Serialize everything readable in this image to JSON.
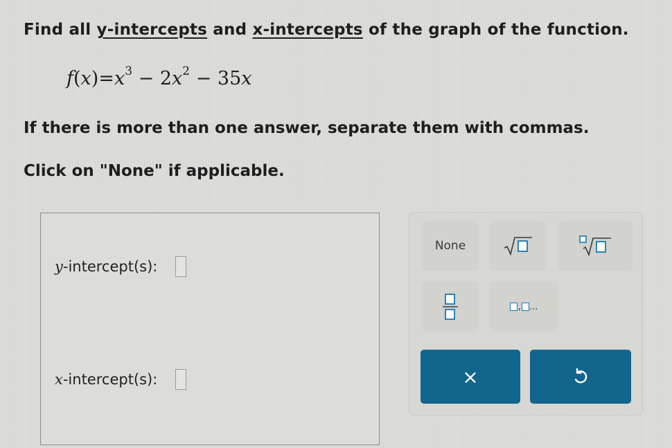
{
  "question": {
    "prefix": "Find all ",
    "term1": "y-intercepts",
    "middle": " and ",
    "term2": "x-intercepts",
    "suffix": " of the graph of the function."
  },
  "function": {
    "name": "f",
    "var": "x",
    "eq": "=",
    "exp1": "3",
    "minus1": "−",
    "coef2": "2",
    "exp2": "2",
    "minus2": "−",
    "coef3": "35"
  },
  "instructions": {
    "line1": "If there is more than one answer, separate them with commas.",
    "line2": "Click on \"None\" if applicable."
  },
  "answers": {
    "y_var": "y",
    "y_label": "-intercept(s):",
    "x_var": "x",
    "x_label": "-intercept(s):"
  },
  "keypad": {
    "none_label": "None",
    "sqrt_icon": "square-root-icon",
    "nroot_icon": "nth-root-icon",
    "fraction_icon": "fraction-icon",
    "list_icon": "list-icon",
    "list_ellipsis": "...",
    "clear_icon": "x-icon",
    "clear_label": "×",
    "undo_icon": "undo-icon"
  },
  "colors": {
    "button_blue": "#12658c",
    "placeholder_blue": "#1677b3",
    "background": "#dcdcd8"
  }
}
